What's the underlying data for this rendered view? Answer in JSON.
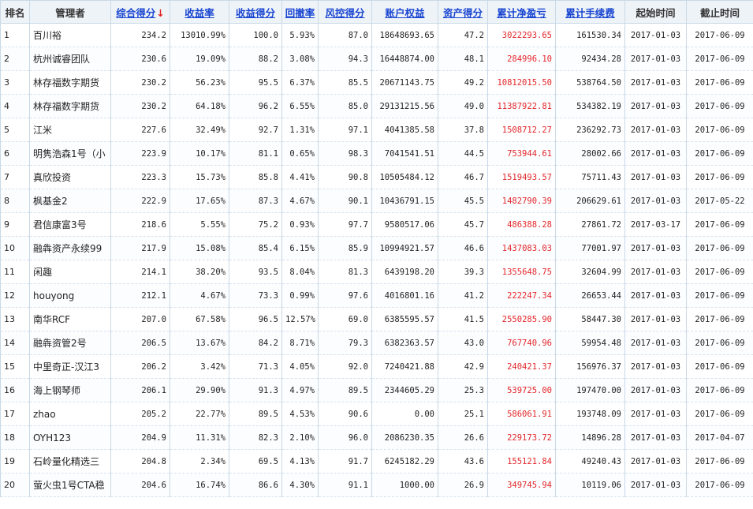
{
  "headers": {
    "rank": "排名",
    "manager": "管理者",
    "total_score": "综合得分",
    "sort_indicator": "↓",
    "return_rate": "收益率",
    "return_score": "收益得分",
    "drawdown": "回撤率",
    "risk_score": "风控得分",
    "equity": "账户权益",
    "asset_score": "资产得分",
    "net_profit": "累计净盈亏",
    "fees": "累计手续费",
    "start_date": "起始时间",
    "end_date": "截止时间"
  },
  "colors": {
    "link": "#1a46d1",
    "profit": "#e3262a",
    "sort_arrow": "#e02020",
    "header_bg": "#eef3f8"
  },
  "rows": [
    {
      "rank": "1",
      "manager": "百川裕",
      "total_score": "234.2",
      "return_rate": "13010.99%",
      "return_score": "100.0",
      "drawdown": "5.93%",
      "risk_score": "87.0",
      "equity": "18648693.65",
      "asset_score": "47.2",
      "net_profit": "3022293.65",
      "fees": "161530.34",
      "start_date": "2017-01-03",
      "end_date": "2017-06-09"
    },
    {
      "rank": "2",
      "manager": "杭州诚睿团队",
      "total_score": "230.6",
      "return_rate": "19.09%",
      "return_score": "88.2",
      "drawdown": "3.08%",
      "risk_score": "94.3",
      "equity": "16448874.00",
      "asset_score": "48.1",
      "net_profit": "284996.10",
      "fees": "92434.28",
      "start_date": "2017-01-03",
      "end_date": "2017-06-09"
    },
    {
      "rank": "3",
      "manager": "林存福数字期货",
      "total_score": "230.2",
      "return_rate": "56.23%",
      "return_score": "95.5",
      "drawdown": "6.37%",
      "risk_score": "85.5",
      "equity": "20671143.75",
      "asset_score": "49.2",
      "net_profit": "10812015.50",
      "fees": "538764.50",
      "start_date": "2017-01-03",
      "end_date": "2017-06-09"
    },
    {
      "rank": "4",
      "manager": "林存福数字期货",
      "total_score": "230.2",
      "return_rate": "64.18%",
      "return_score": "96.2",
      "drawdown": "6.55%",
      "risk_score": "85.0",
      "equity": "29131215.56",
      "asset_score": "49.0",
      "net_profit": "11387922.81",
      "fees": "534382.19",
      "start_date": "2017-01-03",
      "end_date": "2017-06-09"
    },
    {
      "rank": "5",
      "manager": "江米",
      "total_score": "227.6",
      "return_rate": "32.49%",
      "return_score": "92.7",
      "drawdown": "1.31%",
      "risk_score": "97.1",
      "equity": "4041385.58",
      "asset_score": "37.8",
      "net_profit": "1508712.27",
      "fees": "236292.73",
      "start_date": "2017-01-03",
      "end_date": "2017-06-09"
    },
    {
      "rank": "6",
      "manager": "明隽浩森1号（小",
      "total_score": "223.9",
      "return_rate": "10.17%",
      "return_score": "81.1",
      "drawdown": "0.65%",
      "risk_score": "98.3",
      "equity": "7041541.51",
      "asset_score": "44.5",
      "net_profit": "753944.61",
      "fees": "28002.66",
      "start_date": "2017-01-03",
      "end_date": "2017-06-09"
    },
    {
      "rank": "7",
      "manager": "真欣投资",
      "total_score": "223.3",
      "return_rate": "15.73%",
      "return_score": "85.8",
      "drawdown": "4.41%",
      "risk_score": "90.8",
      "equity": "10505484.12",
      "asset_score": "46.7",
      "net_profit": "1519493.57",
      "fees": "75711.43",
      "start_date": "2017-01-03",
      "end_date": "2017-06-09"
    },
    {
      "rank": "8",
      "manager": "枫基金2",
      "total_score": "222.9",
      "return_rate": "17.65%",
      "return_score": "87.3",
      "drawdown": "4.67%",
      "risk_score": "90.1",
      "equity": "10436791.15",
      "asset_score": "45.5",
      "net_profit": "1482790.39",
      "fees": "206629.61",
      "start_date": "2017-01-03",
      "end_date": "2017-05-22"
    },
    {
      "rank": "9",
      "manager": "君信康富3号",
      "total_score": "218.6",
      "return_rate": "5.55%",
      "return_score": "75.2",
      "drawdown": "0.93%",
      "risk_score": "97.7",
      "equity": "9580517.06",
      "asset_score": "45.7",
      "net_profit": "486388.28",
      "fees": "27861.72",
      "start_date": "2017-03-17",
      "end_date": "2017-06-09"
    },
    {
      "rank": "10",
      "manager": "融犇资产永续99",
      "total_score": "217.9",
      "return_rate": "15.08%",
      "return_score": "85.4",
      "drawdown": "6.15%",
      "risk_score": "85.9",
      "equity": "10994921.57",
      "asset_score": "46.6",
      "net_profit": "1437083.03",
      "fees": "77001.97",
      "start_date": "2017-01-03",
      "end_date": "2017-06-09"
    },
    {
      "rank": "11",
      "manager": "闲趣",
      "total_score": "214.1",
      "return_rate": "38.20%",
      "return_score": "93.5",
      "drawdown": "8.04%",
      "risk_score": "81.3",
      "equity": "6439198.20",
      "asset_score": "39.3",
      "net_profit": "1355648.75",
      "fees": "32604.99",
      "start_date": "2017-01-03",
      "end_date": "2017-06-09"
    },
    {
      "rank": "12",
      "manager": "houyong",
      "total_score": "212.1",
      "return_rate": "4.67%",
      "return_score": "73.3",
      "drawdown": "0.99%",
      "risk_score": "97.6",
      "equity": "4016801.16",
      "asset_score": "41.2",
      "net_profit": "222247.34",
      "fees": "26653.44",
      "start_date": "2017-01-03",
      "end_date": "2017-06-09"
    },
    {
      "rank": "13",
      "manager": "南华RCF",
      "total_score": "207.0",
      "return_rate": "67.58%",
      "return_score": "96.5",
      "drawdown": "12.57%",
      "risk_score": "69.0",
      "equity": "6385595.57",
      "asset_score": "41.5",
      "net_profit": "2550285.90",
      "fees": "58447.30",
      "start_date": "2017-01-03",
      "end_date": "2017-06-09"
    },
    {
      "rank": "14",
      "manager": "融犇资管2号",
      "total_score": "206.5",
      "return_rate": "13.67%",
      "return_score": "84.2",
      "drawdown": "8.71%",
      "risk_score": "79.3",
      "equity": "6382363.57",
      "asset_score": "43.0",
      "net_profit": "767740.96",
      "fees": "59954.48",
      "start_date": "2017-01-03",
      "end_date": "2017-06-09"
    },
    {
      "rank": "15",
      "manager": "中里奇正-汉江3",
      "total_score": "206.2",
      "return_rate": "3.42%",
      "return_score": "71.3",
      "drawdown": "4.05%",
      "risk_score": "92.0",
      "equity": "7240421.88",
      "asset_score": "42.9",
      "net_profit": "240421.37",
      "fees": "156976.37",
      "start_date": "2017-01-03",
      "end_date": "2017-06-09"
    },
    {
      "rank": "16",
      "manager": "海上钢琴师",
      "total_score": "206.1",
      "return_rate": "29.90%",
      "return_score": "91.3",
      "drawdown": "4.97%",
      "risk_score": "89.5",
      "equity": "2344605.29",
      "asset_score": "25.3",
      "net_profit": "539725.00",
      "fees": "197470.00",
      "start_date": "2017-01-03",
      "end_date": "2017-06-09"
    },
    {
      "rank": "17",
      "manager": "zhao",
      "total_score": "205.2",
      "return_rate": "22.77%",
      "return_score": "89.5",
      "drawdown": "4.53%",
      "risk_score": "90.6",
      "equity": "0.00",
      "asset_score": "25.1",
      "net_profit": "586061.91",
      "fees": "193748.09",
      "start_date": "2017-01-03",
      "end_date": "2017-06-09"
    },
    {
      "rank": "18",
      "manager": "OYH123",
      "total_score": "204.9",
      "return_rate": "11.31%",
      "return_score": "82.3",
      "drawdown": "2.10%",
      "risk_score": "96.0",
      "equity": "2086230.35",
      "asset_score": "26.6",
      "net_profit": "229173.72",
      "fees": "14896.28",
      "start_date": "2017-01-03",
      "end_date": "2017-04-07"
    },
    {
      "rank": "19",
      "manager": "石岭量化精选三",
      "total_score": "204.8",
      "return_rate": "2.34%",
      "return_score": "69.5",
      "drawdown": "4.13%",
      "risk_score": "91.7",
      "equity": "6245182.29",
      "asset_score": "43.6",
      "net_profit": "155121.84",
      "fees": "49240.43",
      "start_date": "2017-01-03",
      "end_date": "2017-06-09"
    },
    {
      "rank": "20",
      "manager": "萤火虫1号CTA稳",
      "total_score": "204.6",
      "return_rate": "16.74%",
      "return_score": "86.6",
      "drawdown": "4.30%",
      "risk_score": "91.1",
      "equity": "1000.00",
      "asset_score": "26.9",
      "net_profit": "349745.94",
      "fees": "10119.06",
      "start_date": "2017-01-03",
      "end_date": "2017-06-09"
    }
  ]
}
